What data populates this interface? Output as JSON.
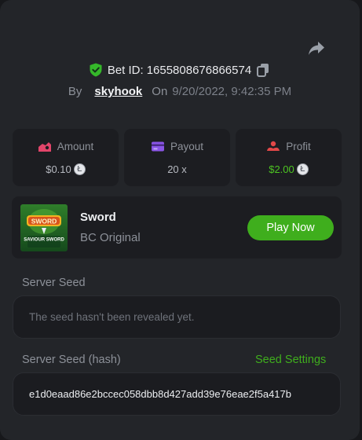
{
  "bet": {
    "id_label": "Bet ID:",
    "id_value": "1655808676866574",
    "by_label": "By",
    "user": "skyhook",
    "on_label": "On",
    "date": "9/20/2022, 9:42:35 PM"
  },
  "stats": {
    "amount": {
      "label": "Amount",
      "value": "$0.10"
    },
    "payout": {
      "label": "Payout",
      "value": "20 x"
    },
    "profit": {
      "label": "Profit",
      "value": "$2.00"
    }
  },
  "game": {
    "title": "Sword",
    "subtitle": "BC Original",
    "play_label": "Play Now",
    "thumb_text_top": "SWORD",
    "thumb_text_bottom": "SAVIOUR SWORD"
  },
  "server_seed": {
    "label": "Server Seed",
    "placeholder": "The seed hasn't been revealed yet."
  },
  "server_seed_hash": {
    "label": "Server Seed (hash)",
    "settings_link": "Seed Settings",
    "value": "e1d0eaad86e2bccec058dbb8d427add39e76eae2f5a417b"
  },
  "colors": {
    "accent_green": "#3fae1d",
    "profit_green": "#4dc422",
    "panel_bg": "#232529",
    "card_bg": "#1c1d21"
  },
  "icons": {
    "share": "share-icon",
    "verified": "shield-check-icon",
    "copy": "copy-icon",
    "amount": "amount-icon",
    "payout": "card-icon",
    "profit": "profit-icon",
    "coin": "coin-icon"
  }
}
